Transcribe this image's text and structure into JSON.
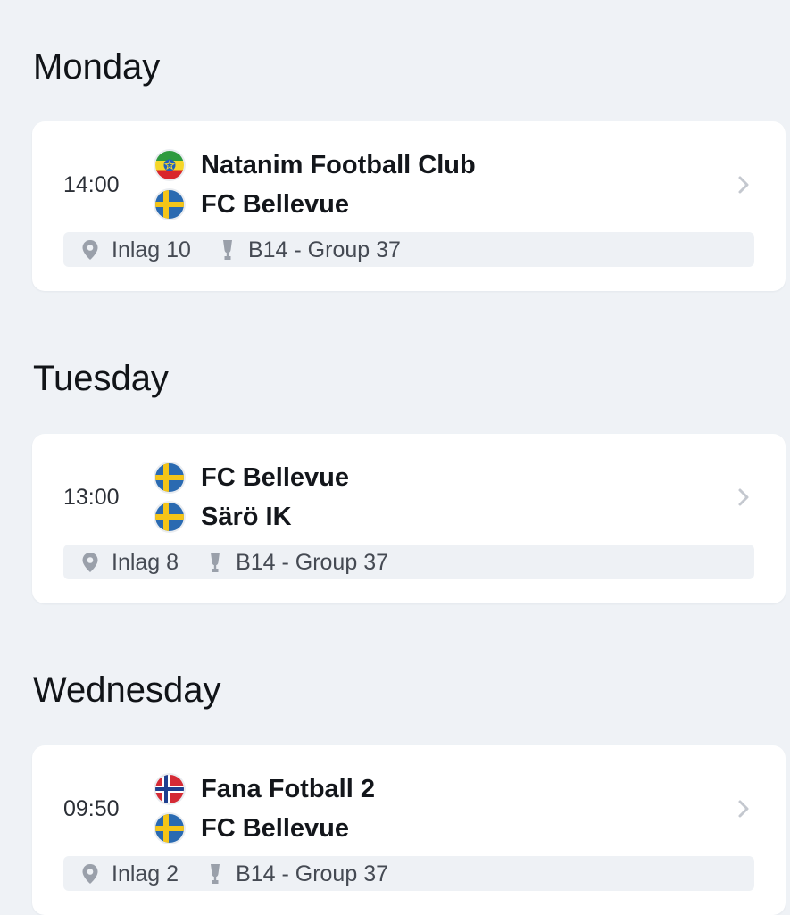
{
  "days": [
    {
      "heading": "Monday",
      "match": {
        "time": "14:00",
        "home": {
          "name": "Natanim Football Club",
          "flag": "ethiopia-flag-icon"
        },
        "away": {
          "name": "FC Bellevue",
          "flag": "sweden-flag-icon"
        },
        "venue": "Inlag 10",
        "group": "B14 - Group 37"
      }
    },
    {
      "heading": "Tuesday",
      "match": {
        "time": "13:00",
        "home": {
          "name": "FC Bellevue",
          "flag": "sweden-flag-icon"
        },
        "away": {
          "name": "Särö IK",
          "flag": "sweden-flag-icon"
        },
        "venue": "Inlag 8",
        "group": "B14 - Group 37"
      }
    },
    {
      "heading": "Wednesday",
      "match": {
        "time": "09:50",
        "home": {
          "name": "Fana Fotball 2",
          "flag": "norway-flag-icon"
        },
        "away": {
          "name": "FC Bellevue",
          "flag": "sweden-flag-icon"
        },
        "venue": "Inlag 2",
        "group": "B14 - Group 37"
      }
    }
  ],
  "colors": {
    "background": "#eff2f6",
    "card": "#ffffff",
    "meta_bar": "#eef1f5",
    "icon_gray": "#9aa0aa",
    "chevron": "#c4c8cf"
  }
}
